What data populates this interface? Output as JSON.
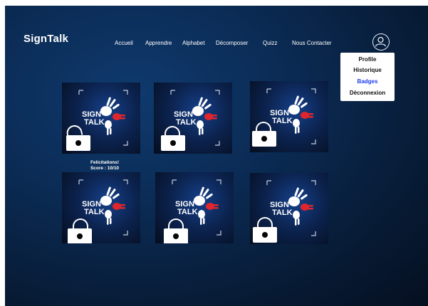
{
  "app": {
    "logo": "SignTalk"
  },
  "nav": {
    "items": [
      "Accueil",
      "Apprendre",
      "Alphabet",
      "Décomposer",
      "Quizz",
      "Nous Contacter"
    ]
  },
  "profile_menu": {
    "items": [
      "Profile",
      "Historique",
      "Badges",
      "Déconnexion"
    ],
    "active": "Badges"
  },
  "badge_art": {
    "line1": "SIGN",
    "line2": "TALK"
  },
  "badges": [
    {
      "status": "unlocked",
      "caption_title": "Felicitations!",
      "caption_score": "Score : 10/10"
    },
    {
      "status": "locked"
    },
    {
      "status": "locked"
    },
    {
      "status": "locked"
    },
    {
      "status": "locked"
    },
    {
      "status": "locked"
    }
  ],
  "colors": {
    "background": "#0b2c56",
    "active_menu": "#1b3cf0",
    "accent_red": "#e0262d"
  }
}
